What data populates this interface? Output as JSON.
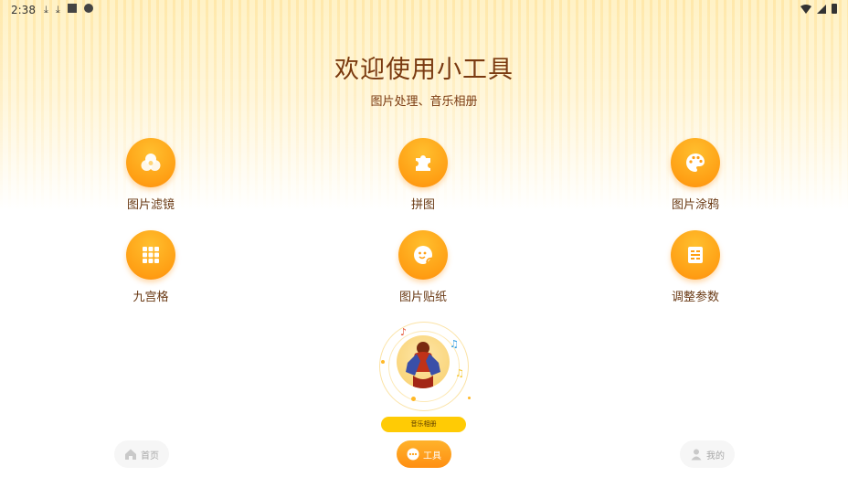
{
  "status_bar": {
    "time": "2:38",
    "left_icons": [
      "download-icon",
      "download-icon",
      "a-icon",
      "alert-icon"
    ],
    "right_icons": [
      "wifi-icon",
      "signal-icon",
      "battery-icon"
    ]
  },
  "header": {
    "title": "欢迎使用小工具",
    "subtitle": "图片处理、音乐相册"
  },
  "tools": [
    {
      "label": "图片滤镜",
      "icon": "filter-circles-icon"
    },
    {
      "label": "拼图",
      "icon": "puzzle-icon"
    },
    {
      "label": "图片涂鸦",
      "icon": "palette-icon"
    },
    {
      "label": "九宫格",
      "icon": "grid-icon"
    },
    {
      "label": "图片贴纸",
      "icon": "sticker-icon"
    },
    {
      "label": "调整参数",
      "icon": "adjust-icon"
    }
  ],
  "music": {
    "button_label": "音乐相册"
  },
  "bottom_nav": {
    "home": "首页",
    "tools": "工具",
    "mine": "我的"
  },
  "colors": {
    "accent": "#ff9f14",
    "title": "#7a3a10",
    "music_button": "#ffcb05"
  }
}
